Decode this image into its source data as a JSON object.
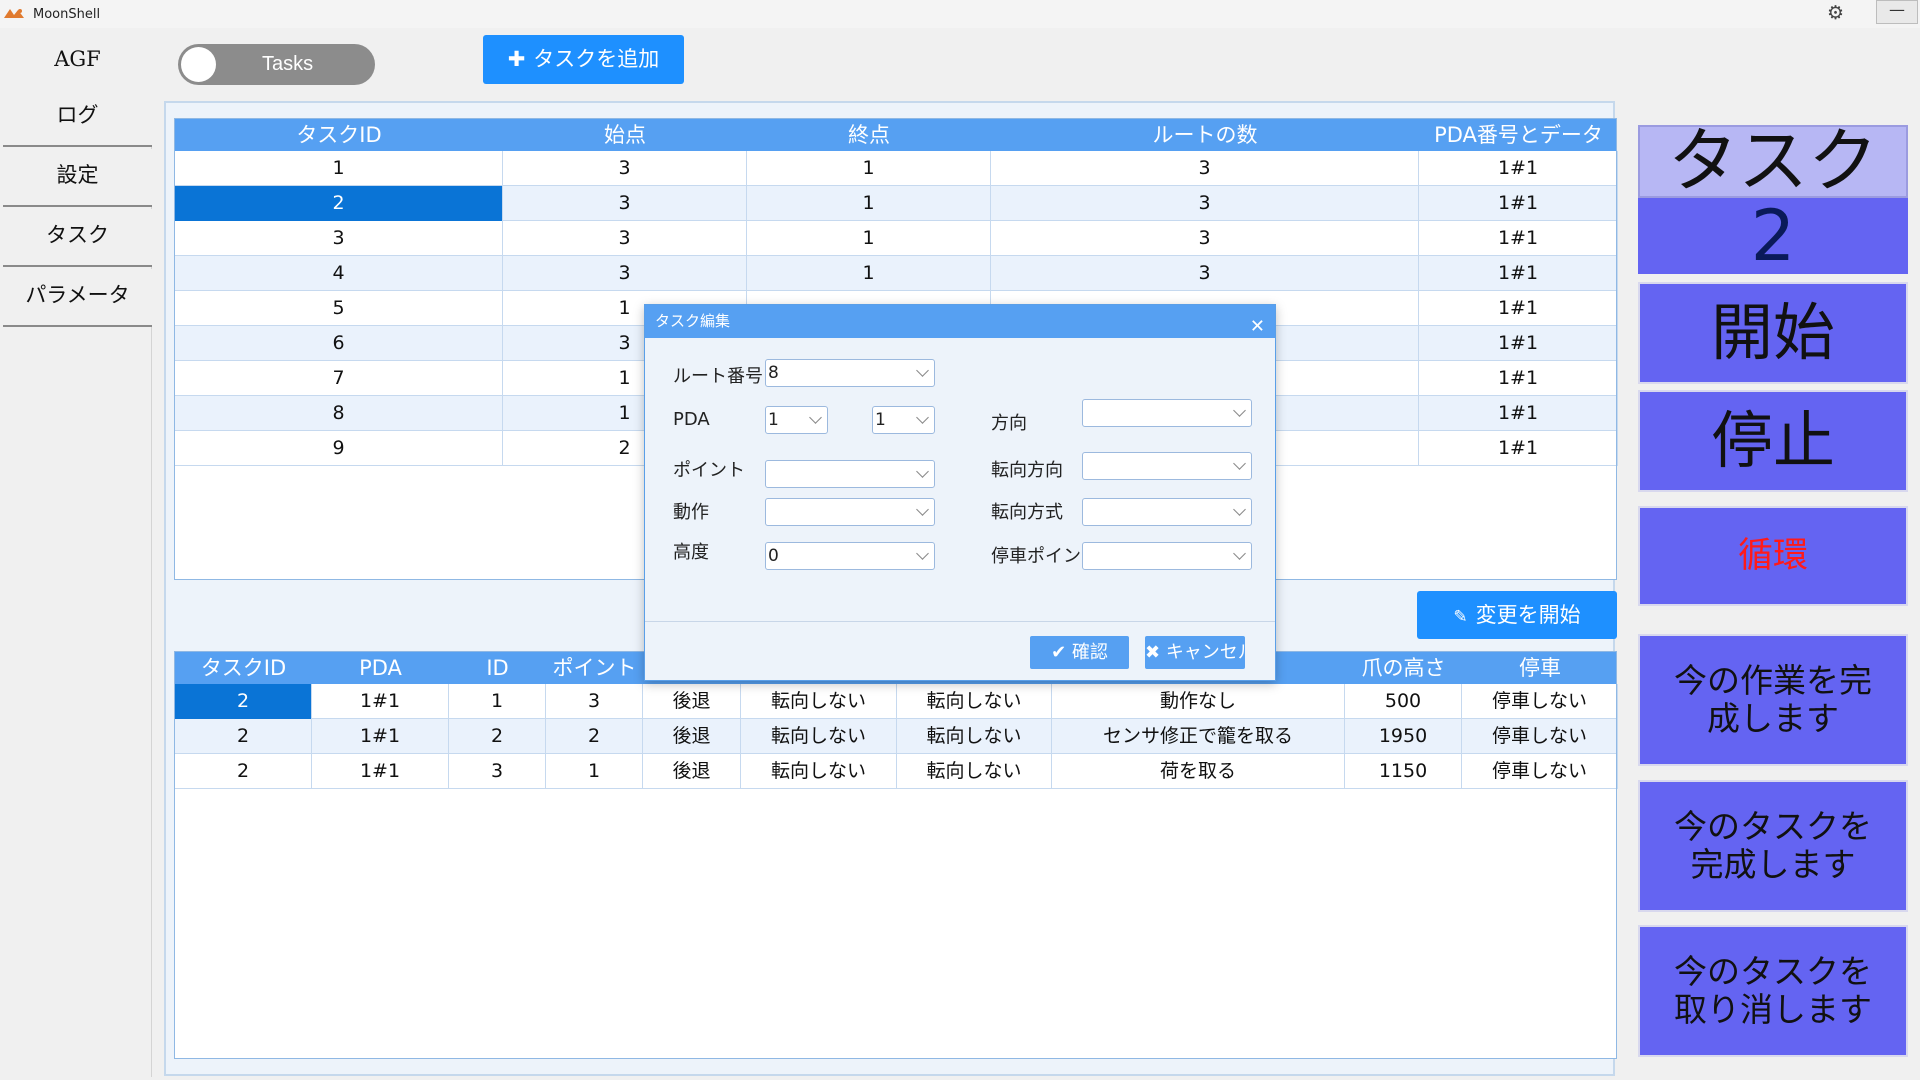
{
  "window": {
    "title": "MoonShell"
  },
  "sidebar": {
    "items": [
      {
        "label": "AGF"
      },
      {
        "label": "ログ"
      },
      {
        "label": "設定"
      },
      {
        "label": "タスク"
      },
      {
        "label": "パラメータ"
      }
    ]
  },
  "toolbar": {
    "toggle_label": "Tasks",
    "toggle_state": "off",
    "add_task_label": "タスクを追加",
    "add_icon": "plus-icon"
  },
  "tasks_table": {
    "columns": [
      "タスクID",
      "始点",
      "終点",
      "ルートの数",
      "PDA番号とデータ"
    ],
    "rows": [
      [
        "1",
        "3",
        "1",
        "3",
        "1#1"
      ],
      [
        "2",
        "3",
        "1",
        "3",
        "1#1"
      ],
      [
        "3",
        "3",
        "1",
        "3",
        "1#1"
      ],
      [
        "4",
        "3",
        "1",
        "3",
        "1#1"
      ],
      [
        "5",
        "1",
        "",
        "",
        "1#1"
      ],
      [
        "6",
        "3",
        "",
        "",
        "1#1"
      ],
      [
        "7",
        "1",
        "",
        "",
        "1#1"
      ],
      [
        "8",
        "1",
        "",
        "",
        "1#1"
      ],
      [
        "9",
        "2",
        "",
        "",
        "1#1"
      ]
    ],
    "selected_row": 1
  },
  "start_change_button": {
    "label": "変更を開始",
    "icon": "edit-icon"
  },
  "routes_table": {
    "columns": [
      "タスクID",
      "PDA",
      "ID",
      "ポイント",
      "",
      "",
      "",
      "",
      "爪の高さ",
      "停車"
    ],
    "rows": [
      [
        "2",
        "1#1",
        "1",
        "3",
        "後退",
        "転向しない",
        "転向しない",
        "動作なし",
        "500",
        "停車しない"
      ],
      [
        "2",
        "1#1",
        "2",
        "2",
        "後退",
        "転向しない",
        "転向しない",
        "センサ修正で籠を取る",
        "1950",
        "停車しない"
      ],
      [
        "2",
        "1#1",
        "3",
        "1",
        "後退",
        "転向しない",
        "転向しない",
        "荷を取る",
        "1150",
        "停車しない"
      ]
    ]
  },
  "right_panel": {
    "title": "タスク",
    "current_task": "2",
    "start": "開始",
    "stop": "停止",
    "loop": "循環",
    "loop_color": "#ff1a1a",
    "complete_work": "今の作業を完成します",
    "complete_task": "今のタスクを完成します",
    "cancel_task": "今のタスクを取り消します"
  },
  "dialog": {
    "title": "タスク編集",
    "route_no_label": "ルート番号",
    "route_no_value": "8",
    "pda_label": "PDA",
    "pda_value_1": "1",
    "pda_value_2": "1",
    "direction_label": "方向",
    "direction_value": "",
    "point_label": "ポイント",
    "point_value": "",
    "turn_direction_label": "転向方向",
    "turn_direction_value": "",
    "action_label": "動作",
    "action_value": "",
    "turn_method_label": "転向方式",
    "turn_method_value": "",
    "height_label": "高度",
    "height_value": "0",
    "stop_point_label": "停車ポイント",
    "stop_point_value": "",
    "confirm_label": "確認",
    "cancel_label": "キャンセル"
  }
}
